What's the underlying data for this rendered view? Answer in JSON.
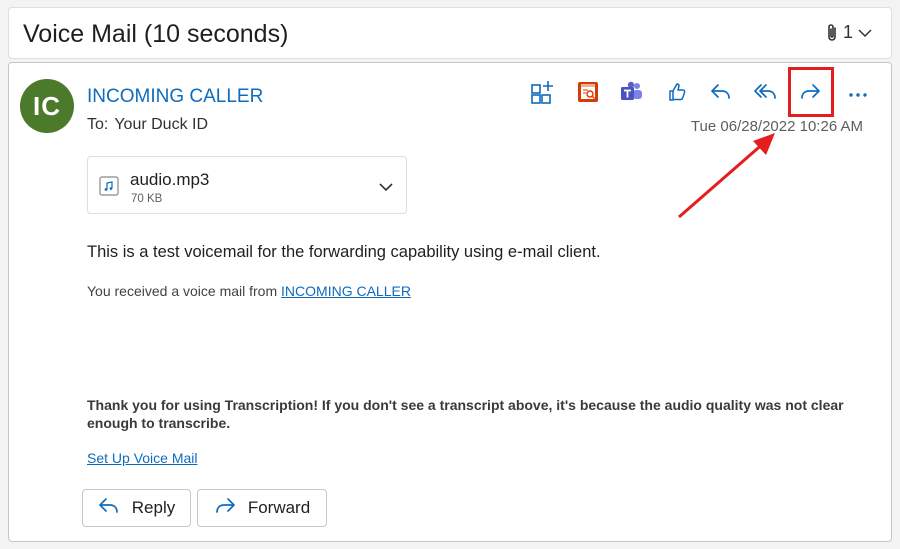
{
  "header": {
    "subject": "Voice Mail (10 seconds)",
    "attachment_count": "1",
    "paperclip_icon": "paperclip-icon",
    "expand_icon": "chevron-down-icon"
  },
  "message": {
    "avatar_initials": "IC",
    "avatar_color": "#4b7a2b",
    "sender": "INCOMING CALLER",
    "to_label": "To:",
    "to_value": "Your Duck ID",
    "timestamp": "Tue 06/28/2022 10:26 AM"
  },
  "toolbar": {
    "icons": [
      "apps-add-icon",
      "calendar-icon",
      "teams-icon",
      "like-icon",
      "reply-icon",
      "reply-all-icon",
      "forward-icon",
      "more-icon"
    ],
    "highlighted_button": "forward-icon",
    "annotation_color": "#e41e1e"
  },
  "attachment": {
    "file_name": "audio.mp3",
    "file_size": "70 KB",
    "icon": "audio-file-icon"
  },
  "body": {
    "main_text": "This is a test voicemail for the forwarding capability using e-mail client.",
    "received_prefix": "You received a voice mail from",
    "received_link": "INCOMING CALLER",
    "thanks_text": "Thank you for using Transcription! If you don't see a transcript above, it's because the audio quality was not clear enough to transcribe.",
    "setup_link": "Set Up Voice Mail"
  },
  "actions": {
    "reply_label": "Reply",
    "forward_label": "Forward"
  },
  "colors": {
    "accent": "#0f6cbd",
    "office_red": "#d83b01",
    "teams_purple": "#5b5fc7"
  }
}
